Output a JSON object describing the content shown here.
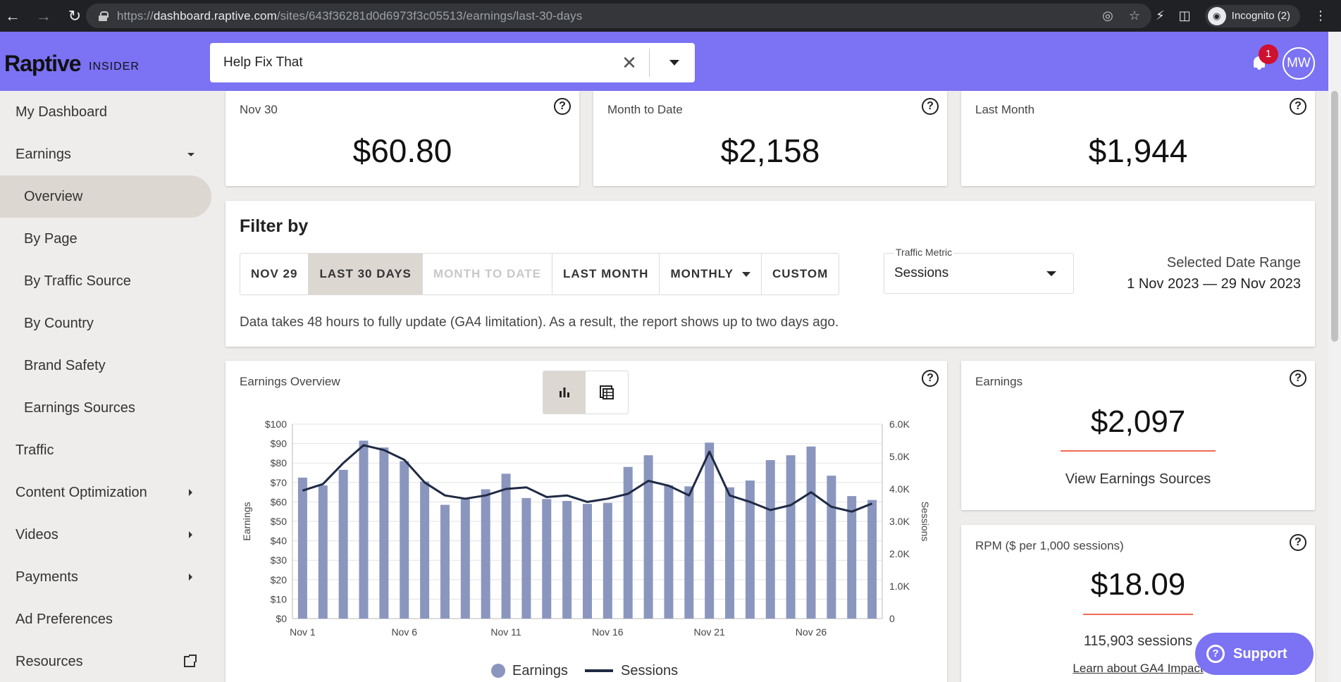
{
  "browser": {
    "url_prefix": "https://",
    "url_domain": "dashboard.raptive.com",
    "url_path": "/sites/643f36281d0d6973f3c05513/earnings/last-30-days",
    "incognito_label": "Incognito (2)"
  },
  "header": {
    "logo": "Raptive",
    "logo_sub": "INSIDER",
    "site_select_value": "Help Fix That",
    "notification_count": "1",
    "user_initials": "MW"
  },
  "sidebar": {
    "items": [
      {
        "label": "My Dashboard"
      },
      {
        "label": "Earnings"
      },
      {
        "label": "Overview"
      },
      {
        "label": "By Page"
      },
      {
        "label": "By Traffic Source"
      },
      {
        "label": "By Country"
      },
      {
        "label": "Brand Safety"
      },
      {
        "label": "Earnings Sources"
      },
      {
        "label": "Traffic"
      },
      {
        "label": "Content Optimization"
      },
      {
        "label": "Videos"
      },
      {
        "label": "Payments"
      },
      {
        "label": "Ad Preferences"
      },
      {
        "label": "Resources"
      }
    ]
  },
  "stats": {
    "day": {
      "label": "Nov 30",
      "value": "$60.80"
    },
    "mtd": {
      "label": "Month to Date",
      "value": "$2,158"
    },
    "last_month": {
      "label": "Last Month",
      "value": "$1,944"
    }
  },
  "filter": {
    "title": "Filter by",
    "buttons": [
      "NOV 29",
      "LAST 30 DAYS",
      "MONTH TO DATE",
      "LAST MONTH",
      "MONTHLY",
      "CUSTOM"
    ],
    "traffic_metric_label": "Traffic Metric",
    "traffic_metric_value": "Sessions",
    "range_label": "Selected Date Range",
    "range_value": "1 Nov 2023 — 29 Nov 2023",
    "note": "Data takes 48 hours to fully update (GA4 limitation). As a result, the report shows up to two days ago."
  },
  "earnings_card": {
    "label": "Earnings",
    "value": "$2,097",
    "link": "View Earnings Sources"
  },
  "rpm_card": {
    "label": "RPM ($ per 1,000 sessions)",
    "value": "$18.09",
    "sessions": "115,903 sessions",
    "link": "Learn about GA4 Impact"
  },
  "support_label": "Support",
  "colors": {
    "accent": "#7b72f4",
    "bar": "#8b96bf",
    "line": "#1f2a44",
    "underline": "#f06a55"
  },
  "chart_data": {
    "type": "bar",
    "title": "Earnings Overview",
    "x_ticks": [
      "Nov 1",
      "Nov 6",
      "Nov 11",
      "Nov 16",
      "Nov 21",
      "Nov 26"
    ],
    "categories": [
      "Nov 1",
      "Nov 2",
      "Nov 3",
      "Nov 4",
      "Nov 5",
      "Nov 6",
      "Nov 7",
      "Nov 8",
      "Nov 9",
      "Nov 10",
      "Nov 11",
      "Nov 12",
      "Nov 13",
      "Nov 14",
      "Nov 15",
      "Nov 16",
      "Nov 17",
      "Nov 18",
      "Nov 19",
      "Nov 20",
      "Nov 21",
      "Nov 22",
      "Nov 23",
      "Nov 24",
      "Nov 25",
      "Nov 26",
      "Nov 27",
      "Nov 28",
      "Nov 29"
    ],
    "ylabel": "Earnings",
    "y2label": "Sessions",
    "ylim": [
      0,
      100
    ],
    "y2lim": [
      0,
      6000
    ],
    "y_ticks": [
      "$0",
      "$10",
      "$20",
      "$30",
      "$40",
      "$50",
      "$60",
      "$70",
      "$80",
      "$90",
      "$100"
    ],
    "y2_ticks": [
      "0",
      "1.0K",
      "2.0K",
      "3.0K",
      "4.0K",
      "5.0K",
      "6.0K"
    ],
    "series": [
      {
        "name": "Earnings",
        "type": "bar",
        "values": [
          72.5,
          68.5,
          76.5,
          91.5,
          88,
          81,
          70.5,
          58.5,
          61.5,
          66.5,
          74.5,
          62,
          61.5,
          60.5,
          59,
          59.5,
          78,
          84,
          68.5,
          68,
          90.5,
          67.5,
          71,
          81.5,
          84,
          88.5,
          73.5,
          63,
          61
        ]
      },
      {
        "name": "Sessions",
        "type": "line",
        "values": [
          3950,
          4150,
          4800,
          5350,
          5200,
          4900,
          4200,
          3800,
          3700,
          3800,
          4000,
          4050,
          3750,
          3800,
          3600,
          3700,
          3850,
          4250,
          4100,
          3800,
          5150,
          3800,
          3600,
          3350,
          3500,
          3900,
          3450,
          3300,
          3550
        ]
      }
    ],
    "legend": [
      "Earnings",
      "Sessions"
    ],
    "legend_position": "bottom"
  }
}
